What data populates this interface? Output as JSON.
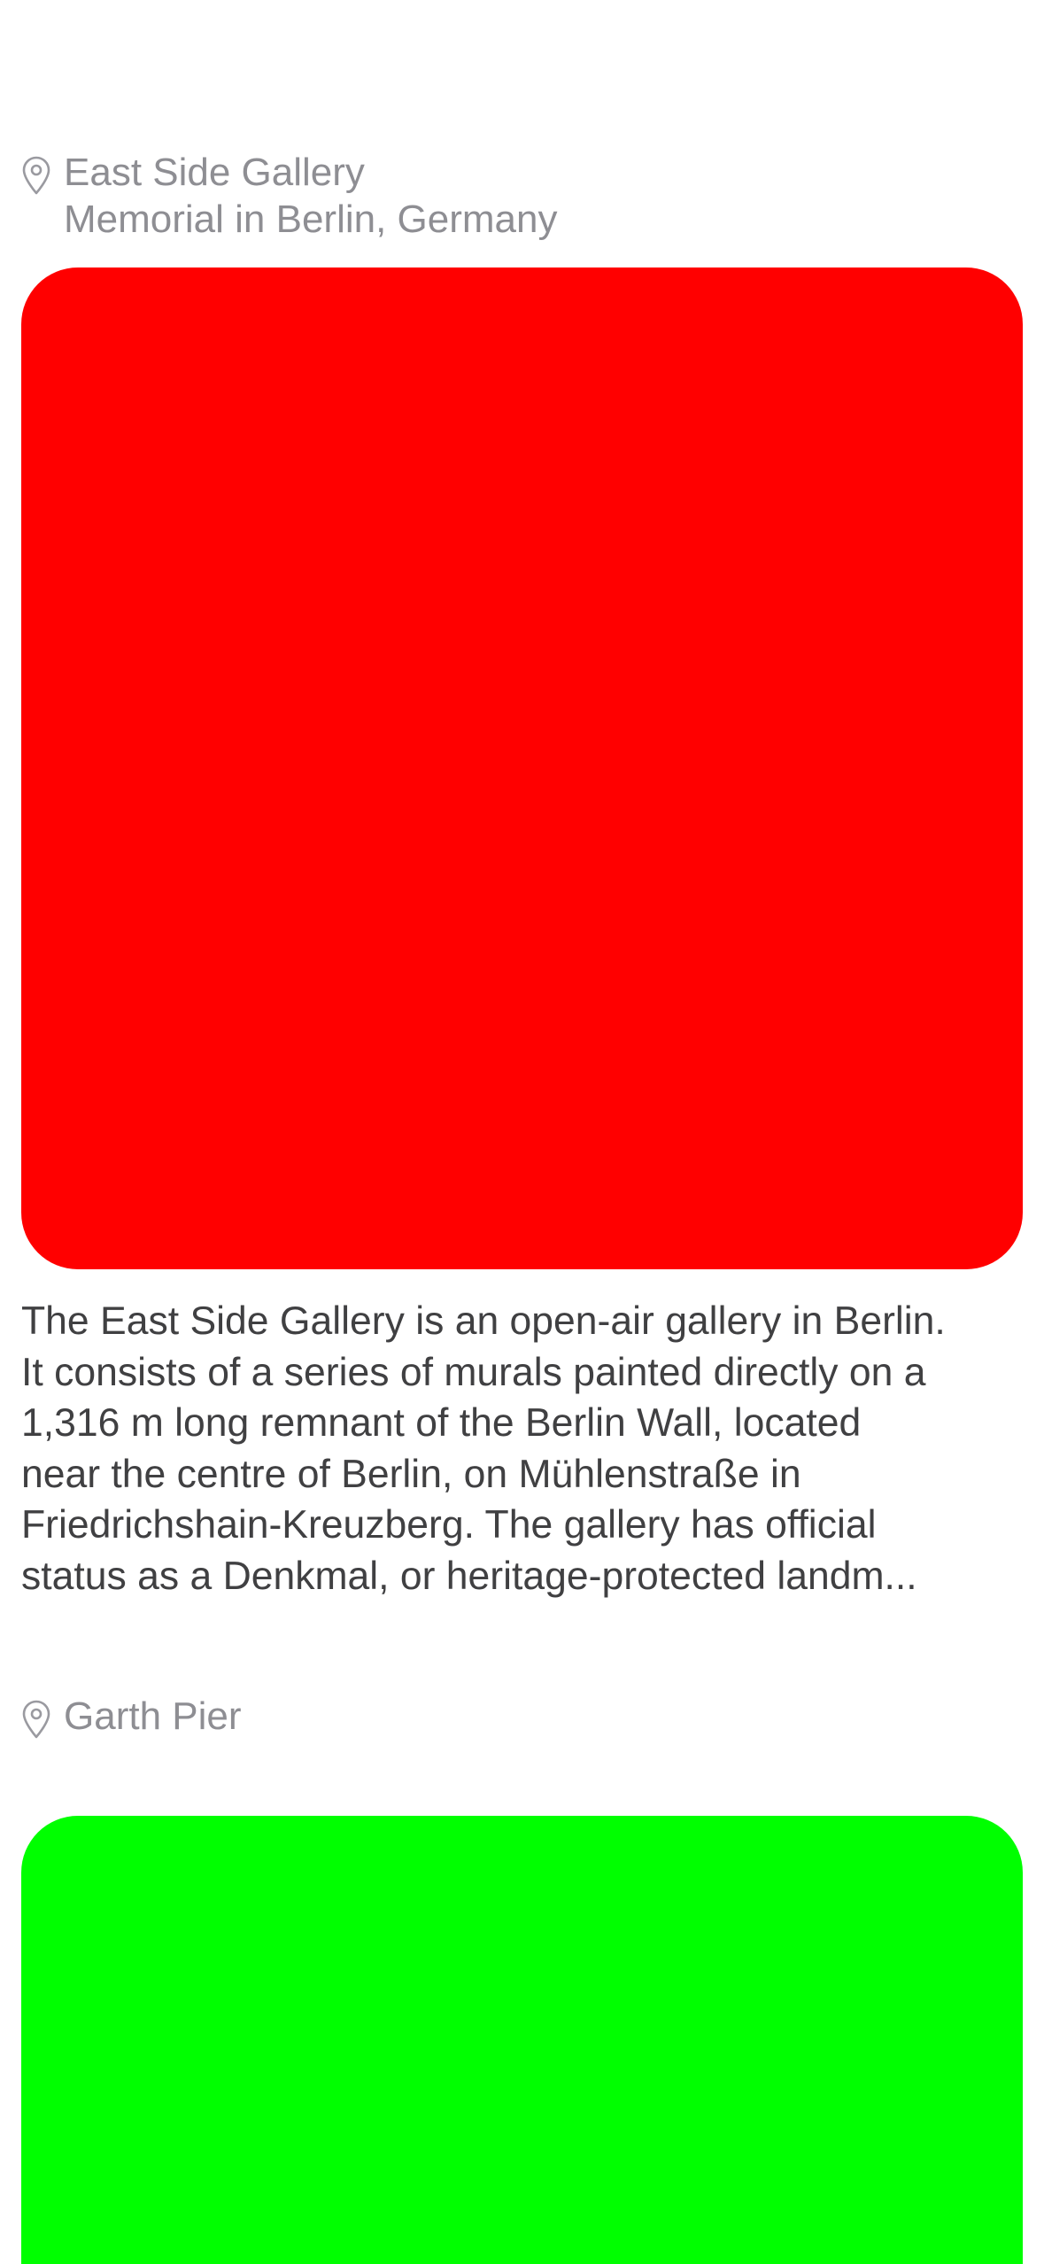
{
  "posts": [
    {
      "location": {
        "name": "East Side Gallery",
        "subtitle": "Memorial in Berlin, Germany",
        "icon": "map-pin-icon"
      },
      "image": {
        "color": "#ff0000"
      },
      "description_lines": [
        "The East Side Gallery is an open-air gallery in Berlin.",
        "It consists of a series of murals painted directly on a",
        "1,316 m long remnant of the Berlin Wall, located",
        "near the centre of Berlin, on Mühlenstraße in",
        "Friedrichshain-Kreuzberg. The gallery has official",
        "status as a Denkmal, or heritage-protected landm..."
      ]
    },
    {
      "location": {
        "name": "Garth Pier",
        "icon": "map-pin-icon"
      },
      "image": {
        "color": "#00ff00"
      }
    }
  ],
  "colors": {
    "location_text": "#8e8e93",
    "description_text": "#404042",
    "background": "#ffffff"
  }
}
